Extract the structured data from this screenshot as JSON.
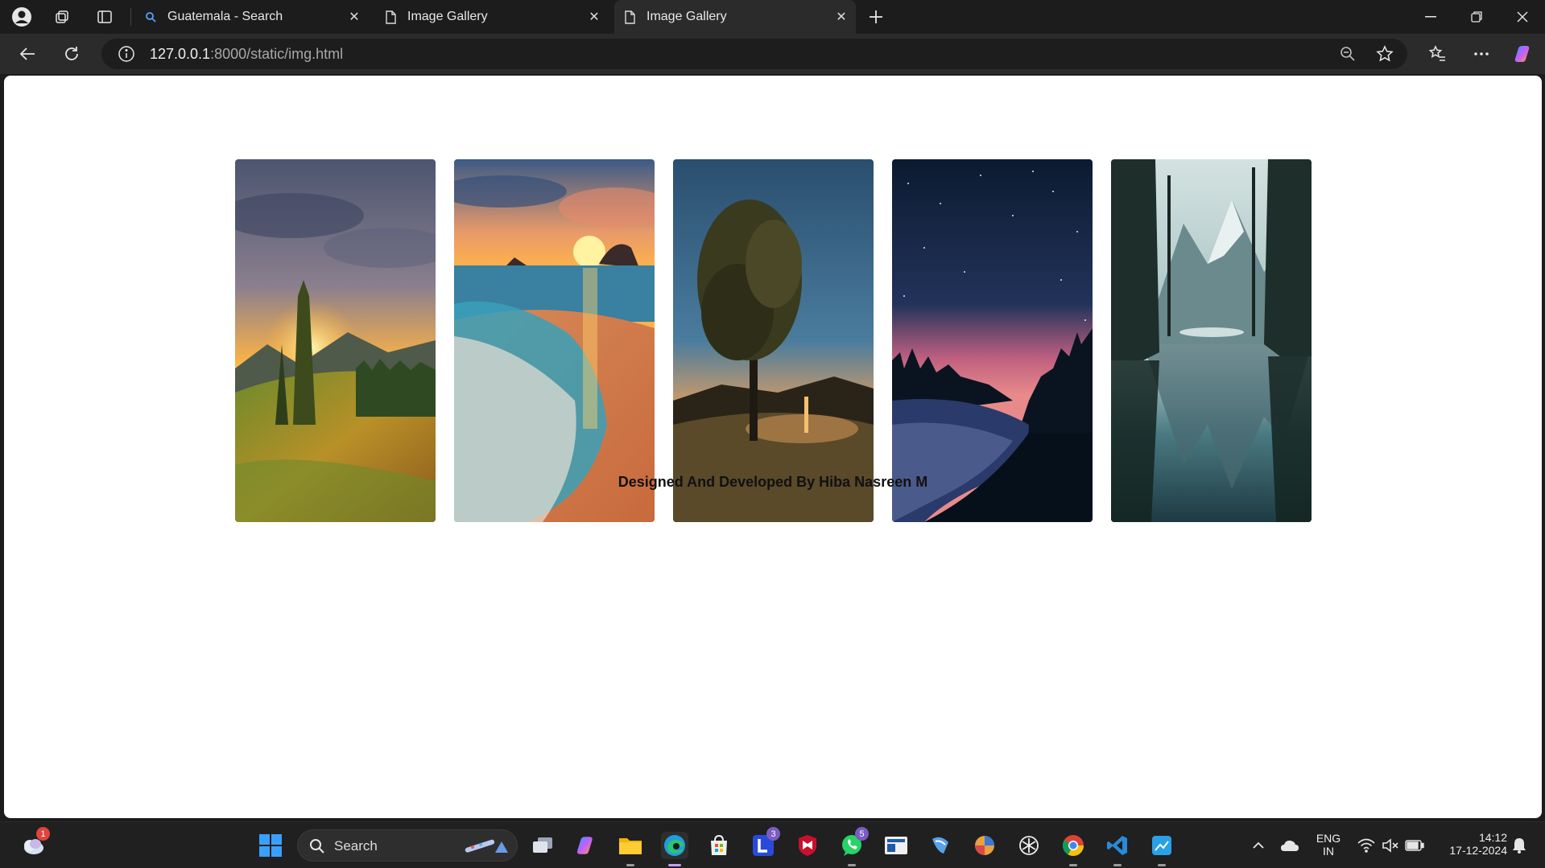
{
  "browser": {
    "tabs": [
      {
        "label": "Guatemala - Search",
        "favicon": "search-icon",
        "active": false
      },
      {
        "label": "Image Gallery",
        "favicon": "page-icon",
        "active": false
      },
      {
        "label": "Image Gallery",
        "favicon": "page-icon",
        "active": true
      }
    ],
    "address": {
      "host": "127.0.0.1",
      "path": ":8000/static/img.html"
    }
  },
  "page": {
    "images": [
      {
        "alt": "sunset meadow with cypress trees"
      },
      {
        "alt": "sunset beach with waves"
      },
      {
        "alt": "lone tree at dusk with crescent moon"
      },
      {
        "alt": "night sky with crescent moon over lake"
      },
      {
        "alt": "mountain lake reflection with pines"
      }
    ],
    "footer": "Designed And Developed By Hiba Nasreen M"
  },
  "taskbar": {
    "weather_badge": "1",
    "search_label": "Search",
    "badges": {
      "l_app": "3",
      "whatsapp": "5"
    },
    "lang_line1": "ENG",
    "lang_line2": "IN",
    "time": "14:12",
    "date": "17-12-2024"
  },
  "colors": {
    "accent": "#6b8cff",
    "page_bg": "#ffffff",
    "chrome_bg": "#1c1c1c"
  }
}
